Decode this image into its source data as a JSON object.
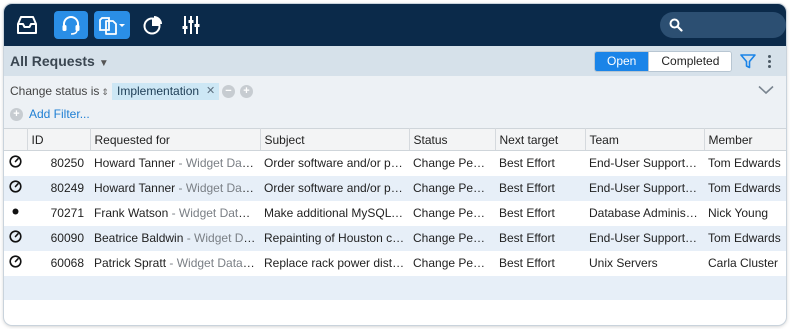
{
  "header": {
    "nav_icons": [
      "inbox-icon",
      "headset-icon",
      "documents-icon",
      "pie-chart-icon",
      "sliders-icon"
    ]
  },
  "view": {
    "title": "All Requests",
    "segments": {
      "open": "Open",
      "completed": "Completed"
    }
  },
  "filter": {
    "condition": "Change status is",
    "value": "Implementation",
    "add_label": "Add Filter..."
  },
  "table": {
    "columns": [
      "ID",
      "Requested for",
      "Subject",
      "Status",
      "Next target",
      "Team",
      "Member"
    ],
    "rows": [
      {
        "icon": "timer-icon",
        "id": "80250",
        "requester": "Howard Tanner",
        "org": " - Widget Data Center",
        "subject": "Order software and/or products",
        "status": "Change Pending",
        "target": "Best Effort",
        "team": "End-User Support, Boston",
        "member": "Tom Edwards"
      },
      {
        "icon": "timer-icon",
        "id": "80249",
        "requester": "Howard Tanner",
        "org": " - Widget Data Center",
        "subject": "Order software and/or products",
        "status": "Change Pending",
        "target": "Best Effort",
        "team": "End-User Support, Boston",
        "member": "Tom Edwards"
      },
      {
        "icon": "dot-icon",
        "id": "70271",
        "requester": "Frank Watson",
        "org": " - Widget Data Center",
        "subject": "Make additional MySQL database",
        "status": "Change Pending",
        "target": "Best Effort",
        "team": "Database Administration",
        "member": "Nick Young"
      },
      {
        "icon": "timer-icon",
        "id": "60090",
        "requester": "Beatrice Baldwin",
        "org": " - Widget Data Center",
        "subject": "Repainting of Houston computer room",
        "status": "Change Pending",
        "target": "Best Effort",
        "team": "End-User Support, Houston",
        "member": "Tom Edwards"
      },
      {
        "icon": "timer-icon",
        "id": "60068",
        "requester": "Patrick Spratt",
        "org": " - Widget Data Center",
        "subject": "Replace rack power distribution",
        "status": "Change Pending",
        "target": "Best Effort",
        "team": "Unix Servers",
        "member": "Carla Cluster"
      }
    ]
  }
}
